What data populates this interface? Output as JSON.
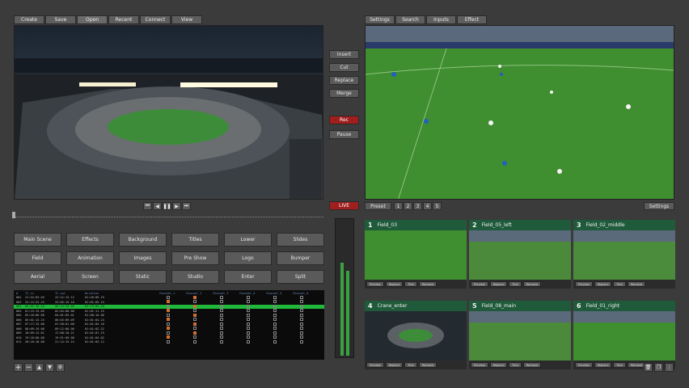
{
  "toolbar_left": [
    "Create",
    "Save",
    "Open",
    "Recent",
    "Connect",
    "View"
  ],
  "toolbar_right": [
    "Settings",
    "Search",
    "Inputs",
    "Effect"
  ],
  "side_buttons": {
    "insert": "Insert",
    "cut": "Cut",
    "replace": "Replace",
    "merge": "Merge",
    "rec": "Rec",
    "pause": "Pause",
    "live": "LIVE"
  },
  "scene_buttons": [
    "Main Scene",
    "Effects",
    "Background",
    "Titles",
    "Lower",
    "Slides",
    "Field",
    "Animation",
    "Images",
    "Pre Show",
    "Logo",
    "Bumper",
    "Aerial",
    "Screen",
    "Static",
    "Studio",
    "Enter",
    "Split"
  ],
  "preset": {
    "label": "Preset",
    "numbers": [
      "1",
      "2",
      "3",
      "4",
      "5"
    ],
    "settings": "Settings"
  },
  "thumbs": [
    {
      "num": "1",
      "name": "Field_03"
    },
    {
      "num": "2",
      "name": "Field_05_left"
    },
    {
      "num": "3",
      "name": "Field_02_middle"
    },
    {
      "num": "4",
      "name": "Crane_enter"
    },
    {
      "num": "5",
      "name": "Field_08_main"
    },
    {
      "num": "6",
      "name": "Field_01_right"
    }
  ],
  "thumb_buttons": [
    "Preview",
    "Replace",
    "Trim",
    "Remove"
  ],
  "table": {
    "headers": [
      "#",
      "TC_in",
      "TC_out",
      "Duration",
      "Channel_1",
      "Channel_2",
      "Channel_3",
      "Channel_4",
      "Channel_5",
      "Channel_6"
    ],
    "rows": [
      [
        "001",
        "21:44:03.03",
        "22:12:13.12",
        "01:28:09.19"
      ],
      [
        "002",
        "22:13:22.23",
        "23:05:15.18",
        "01:01:05.15"
      ],
      [
        "003",
        "00:01:16.10",
        "00:14:20.05",
        "01:13:04.20"
      ],
      [
        "004",
        "01:15:15.05",
        "02:04:00.00",
        "01:01:11.15"
      ],
      [
        "005",
        "03:18:00.00",
        "04:01:05.01",
        "01:08:16.00"
      ],
      [
        "006",
        "05:01:15.15",
        "06:03:09.09",
        "01:01:04.24"
      ],
      [
        "007",
        "07:17:15.00",
        "07:58:01.00",
        "01:01:05.10"
      ],
      [
        "008",
        "08:09:19.00",
        "09:12:00.00",
        "01:01:02.22"
      ],
      [
        "009",
        "16:09:12.01",
        "17:08:10.21",
        "01:01:07.19"
      ],
      [
        "010",
        "19:18:00.00",
        "19:51:09.00",
        "01:01:04.02"
      ],
      [
        "011",
        "20:18:18.00",
        "21:14:15.15",
        "01:01:05.12"
      ]
    ],
    "highlight_row": 2
  },
  "colors": {
    "accent_green": "#1f5a3a",
    "highlight_row": "#1fb83a",
    "rec_red": "#a01e1e",
    "orange_check": "#d07030"
  },
  "level_meter": {
    "left": 0.68,
    "right": 0.62
  }
}
